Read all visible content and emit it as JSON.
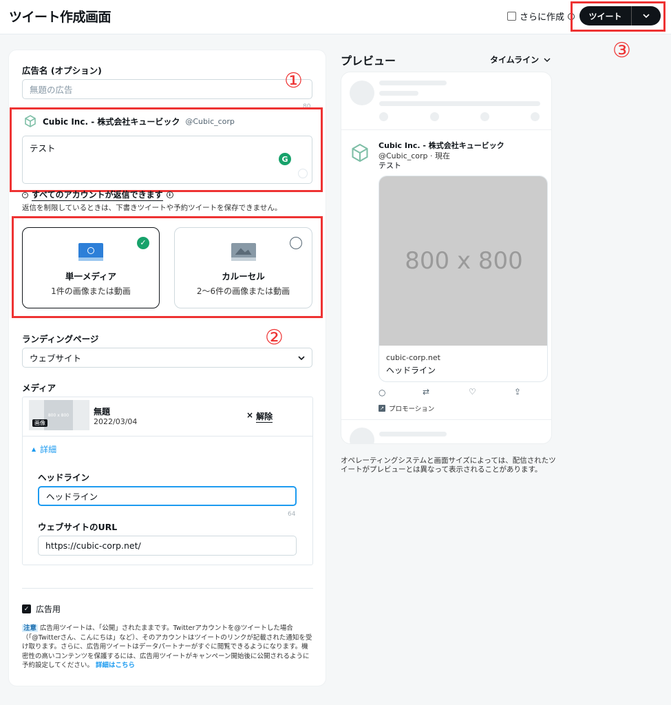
{
  "header": {
    "title": "ツイート作成画面",
    "more_label": "さらに作成",
    "tweet_button": "ツイート"
  },
  "annotations": {
    "one": "①",
    "two": "②",
    "three": "③"
  },
  "form": {
    "ad_name_label": "広告名 (オプション)",
    "ad_name_placeholder": "無題の広告",
    "ad_name_count": "80",
    "account_name": "Cubic Inc. - 株式会社キュービック",
    "account_handle": "@Cubic_corp",
    "tweet_text": "テスト",
    "reply_setting": "すべてのアカウントが返信できます",
    "reply_note": "返信を制限しているときは、下書きツイートや予約ツイートを保存できません。",
    "cards": [
      {
        "title": "単一メディア",
        "sub": "1件の画像または動画"
      },
      {
        "title": "カルーセル",
        "sub": "2〜6件の画像または動画"
      }
    ],
    "landing_label": "ランディングページ",
    "landing_value": "ウェブサイト",
    "media_label": "メディア",
    "media_item": {
      "thumb_text": "800 x 800",
      "badge": "画像",
      "name": "無題",
      "date": "2022/03/04",
      "remove_label": "解除"
    },
    "details_label": "詳細",
    "headline_label": "ヘッドライン",
    "headline_value": "ヘッドライン",
    "headline_count": "64",
    "url_label": "ウェブサイトのURL",
    "url_value": "https://cubic-corp.net/",
    "promoted_label": "広告用",
    "notice_badge": "注意",
    "notice_text": "広告用ツイートは、「公開」されたままです。Twitterアカウントを@ツイートした場合（「@Twitterさん、こんにちは」など）、そのアカウントはツイートのリンクが記載された通知を受け取ります。さらに、広告用ツイートはデータパートナーがすぐに閲覧できるようになります。機密性の高いコンテンツを保護するには、広告用ツイートがキャンペーン開始後に公開されるように予約設定してください。",
    "notice_link": "詳細はこちら"
  },
  "preview": {
    "title": "プレビュー",
    "timeline_label": "タイムライン",
    "account_name": "Cubic Inc. - 株式会社キュービック",
    "handle_time": "@Cubic_corp · 現在",
    "text": "テスト",
    "image_text": "800 x 800",
    "card_domain": "cubic-corp.net",
    "card_headline": "ヘッドライン",
    "promotion_label": "プロモーション",
    "note": "オペレーティングシステムと画面サイズによっては、配信されたツイートがプレビューとは異なって表示されることがあります。"
  },
  "colors": {
    "accent_green": "#17a26b",
    "accent_blue": "#1d9bf0",
    "annotation_red": "#e33333"
  }
}
